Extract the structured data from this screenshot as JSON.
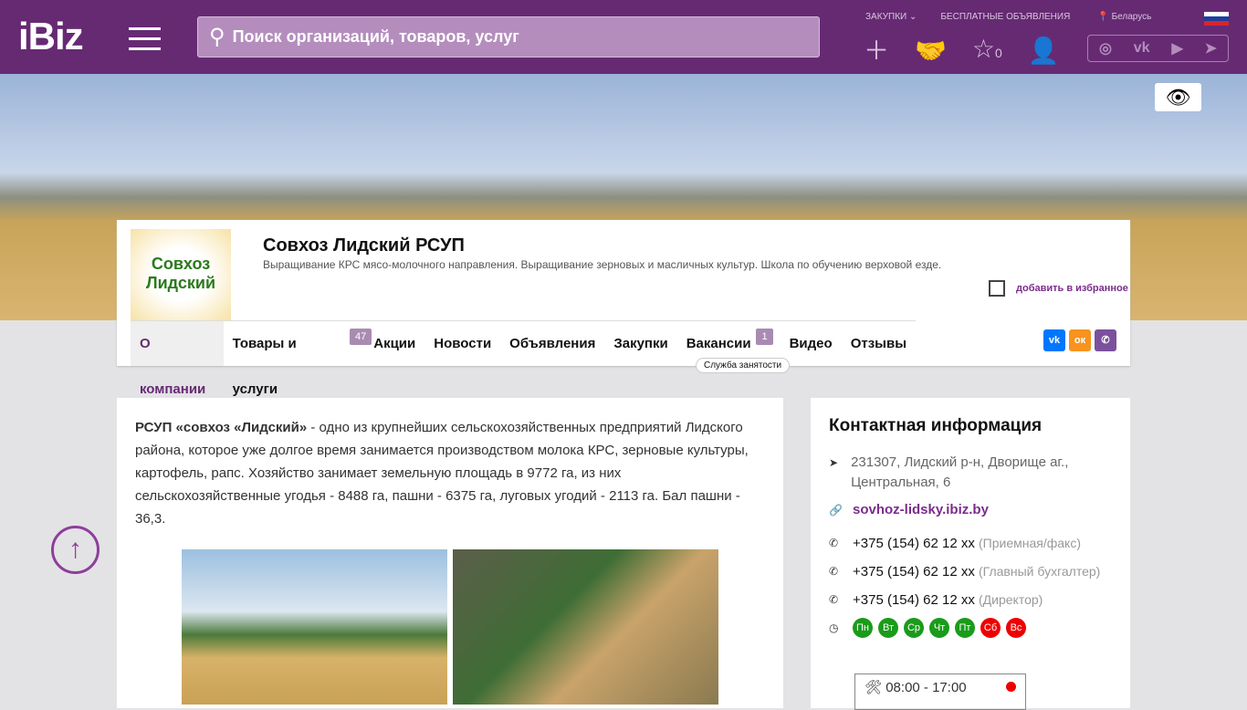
{
  "header": {
    "logo": "iBiz",
    "search_placeholder": "Поиск организаций, товаров, услуг",
    "links": [
      "ЗАКУПКИ ⌄",
      "БЕСПЛАТНЫЕ ОБЪЯВЛЕНИЯ"
    ],
    "region": "Беларусь",
    "favorites_count": "0"
  },
  "company": {
    "logo_text": "Совхоз Лидский",
    "title": "Совхоз Лидский РСУП",
    "description": "Выращивание КРС мясо-молочного направления. Выращивание зерновых и масличных культур. Школа по обучению верховой езде.",
    "favorite_label": "добавить в избранное"
  },
  "tabs": [
    {
      "label": "О компании"
    },
    {
      "label": "Товары и услуги",
      "badge": "47"
    },
    {
      "label": "Акции"
    },
    {
      "label": "Новости"
    },
    {
      "label": "Объявления"
    },
    {
      "label": "Закупки"
    },
    {
      "label": "Вакансии",
      "badge": "1"
    },
    {
      "label": "Видео"
    },
    {
      "label": "Отзывы"
    }
  ],
  "tooltip": "Служба занятости",
  "about": {
    "bold": "РСУП «совхоз «Лидский»",
    "text": " - одно из крупнейших сельскохозяйственных предприятий Лидского района, которое уже долгое время занимается производством молока КРС, зерновые культуры, картофель, рапс. Хозяйство занимает земельную площадь в 9772 га,  из них сельскохозяйственные угодья - 8488 га, пашни - 6375 га, луговых угодий - 2113 га. Бал пашни - 36,3."
  },
  "contacts": {
    "title": "Контактная информация",
    "address": "231307, Лидский р-н, Дворище аг., Центральная, 6",
    "site": "sovhoz-lidsky.ibiz.by",
    "phones": [
      {
        "number": "+375 (154) 62 12 xx",
        "note": "(Приемная/факс)"
      },
      {
        "number": "+375 (154) 62 12 xx",
        "note": "(Главный бухгалтер)"
      },
      {
        "number": "+375 (154) 62 12 xx",
        "note": "(Директор)"
      }
    ],
    "days": [
      "Пн",
      "Вт",
      "Ср",
      "Чт",
      "Пт",
      "Сб",
      "Вс"
    ],
    "hours": "08:00 - 17:00"
  }
}
